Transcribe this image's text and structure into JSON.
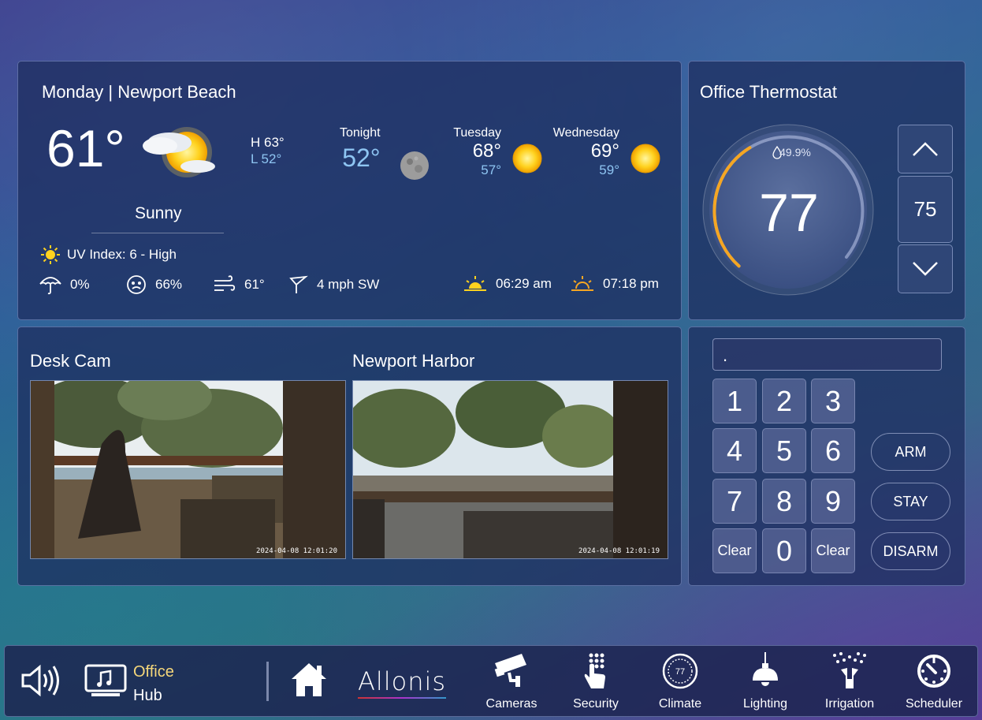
{
  "weather": {
    "title": "Monday | Newport Beach",
    "current_temp": "61°",
    "high": "H 63°",
    "low": "L 52°",
    "condition": "Sunny",
    "uv_index": "UV Index: 6 - High",
    "precip": "0%",
    "humidity": "66%",
    "feels_like": "61°",
    "wind": "4 mph SW",
    "sunrise": "06:29 am",
    "sunset": "07:18 pm",
    "forecast": [
      {
        "day": "Tonight",
        "hi": "52°",
        "lo": ""
      },
      {
        "day": "Tuesday",
        "hi": "68°",
        "lo": "57°"
      },
      {
        "day": "Wednesday",
        "hi": "69°",
        "lo": "59°"
      }
    ]
  },
  "thermostat": {
    "title": "Office Thermostat",
    "humidity": "49.9%",
    "current": "77",
    "setpoint": "75",
    "heat_fraction": 0.4
  },
  "cameras": [
    {
      "title": "Desk Cam",
      "timestamp": "2024-04-08  12:01:20"
    },
    {
      "title": "Newport Harbor",
      "timestamp": "2024-04-08  12:01:19"
    }
  ],
  "keypad": {
    "display": ".",
    "keys": [
      "1",
      "2",
      "3",
      "4",
      "5",
      "6",
      "7",
      "8",
      "9",
      "Clear",
      "0",
      "Clear"
    ],
    "modes": [
      "ARM",
      "STAY",
      "DISARM"
    ]
  },
  "bar": {
    "room_line1": "Office",
    "room_line2": "Hub",
    "brand": "Allonis",
    "nav": [
      "Cameras",
      "Security",
      "Climate",
      "Lighting",
      "Irrigation",
      "Scheduler"
    ],
    "climate_icon_value": "77"
  },
  "colors": {
    "accent": "#f5a623",
    "forecast_low": "#8ec5f2",
    "room": "#f5d77a"
  }
}
